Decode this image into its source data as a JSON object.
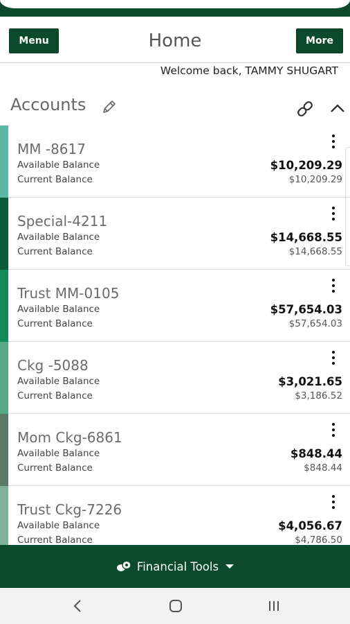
{
  "header": {
    "menu_label": "Menu",
    "title": "Home",
    "more_label": "More"
  },
  "welcome": "Welcome back, TAMMY SHUGART",
  "accounts_section": {
    "title": "Accounts"
  },
  "accounts": [
    {
      "name": "MM -8617",
      "available_label": "Available Balance",
      "current_label": "Current Balance",
      "available": "$10,209.29",
      "current": "$10,209.29",
      "color": "#5db8a6"
    },
    {
      "name": "Special-4211",
      "available_label": "Available Balance",
      "current_label": "Current Balance",
      "available": "$14,668.55",
      "current": "$14,668.55",
      "color": "#0b5a3a"
    },
    {
      "name": "Trust MM-0105",
      "available_label": "Available Balance",
      "current_label": "Current Balance",
      "available": "$57,654.03",
      "current": "$57,654.03",
      "color": "#128a55"
    },
    {
      "name": "Ckg -5088",
      "available_label": "Available Balance",
      "current_label": "Current Balance",
      "available": "$3,021.65",
      "current": "$3,186.52",
      "color": "#57a886"
    },
    {
      "name": "Mom Ckg-6861",
      "available_label": "Available Balance",
      "current_label": "Current Balance",
      "available": "$848.44",
      "current": "$848.44",
      "color": "#5a7a68"
    },
    {
      "name": "Trust Ckg-7226",
      "available_label": "Available Balance",
      "current_label": "Current Balance",
      "available": "$4,056.67",
      "current": "$4,786.50",
      "color": "#7fb09a"
    }
  ],
  "financial_tools": {
    "label": "Financial Tools"
  },
  "colors": {
    "brand_green": "#0b4a2c"
  }
}
